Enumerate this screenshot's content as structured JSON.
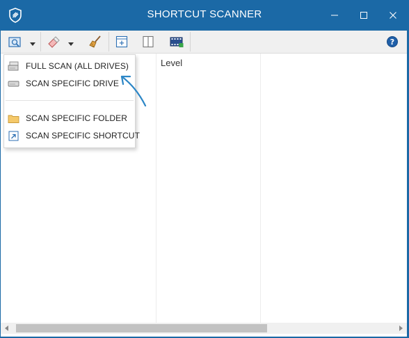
{
  "window": {
    "title": "SHORTCUT SCANNER"
  },
  "grid": {
    "columns": [
      "",
      "Level",
      ""
    ]
  },
  "menu": {
    "items": [
      {
        "label": "FULL SCAN (ALL DRIVES)",
        "icon": "drives-icon"
      },
      {
        "label": "SCAN SPECIFIC DRIVE",
        "icon": "drive-icon"
      },
      {
        "label": "SCAN SPECIFIC FOLDER",
        "icon": "folder-icon"
      },
      {
        "label": "SCAN SPECIFIC SHORTCUT",
        "icon": "shortcut-icon"
      }
    ]
  },
  "colors": {
    "titlebar": "#1b69a6",
    "pointer_arrow": "#2c86c6",
    "help": "#1f5fa8"
  }
}
